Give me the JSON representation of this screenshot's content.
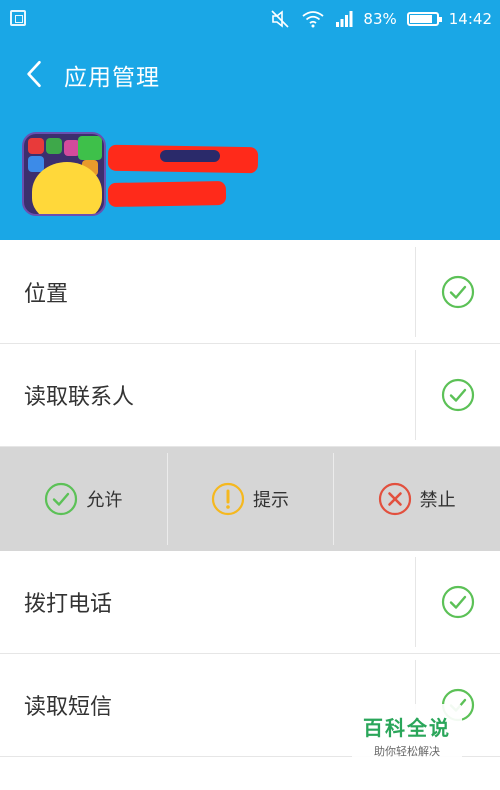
{
  "status_bar": {
    "battery": "83%",
    "time": "14:42"
  },
  "appbar": {
    "title": "应用管理"
  },
  "permissions": [
    {
      "label": "位置",
      "state": "allow"
    },
    {
      "label": "读取联系人",
      "state": "allow"
    },
    {
      "label": "拨打电话",
      "state": "allow"
    },
    {
      "label": "读取短信",
      "state": "allow"
    }
  ],
  "action_options": [
    {
      "label": "允许",
      "icon": "check-circle-icon",
      "color": "#5cc157"
    },
    {
      "label": "提示",
      "icon": "alert-circle-icon",
      "color": "#f5b81f"
    },
    {
      "label": "禁止",
      "icon": "x-circle-icon",
      "color": "#e2503e"
    }
  ],
  "watermark": {
    "main": "百科全说",
    "sub": "助你轻松解决"
  },
  "colors": {
    "primary": "#1aa7e6",
    "allow": "#5cc157",
    "prompt": "#f5b81f",
    "deny": "#e2503e"
  }
}
